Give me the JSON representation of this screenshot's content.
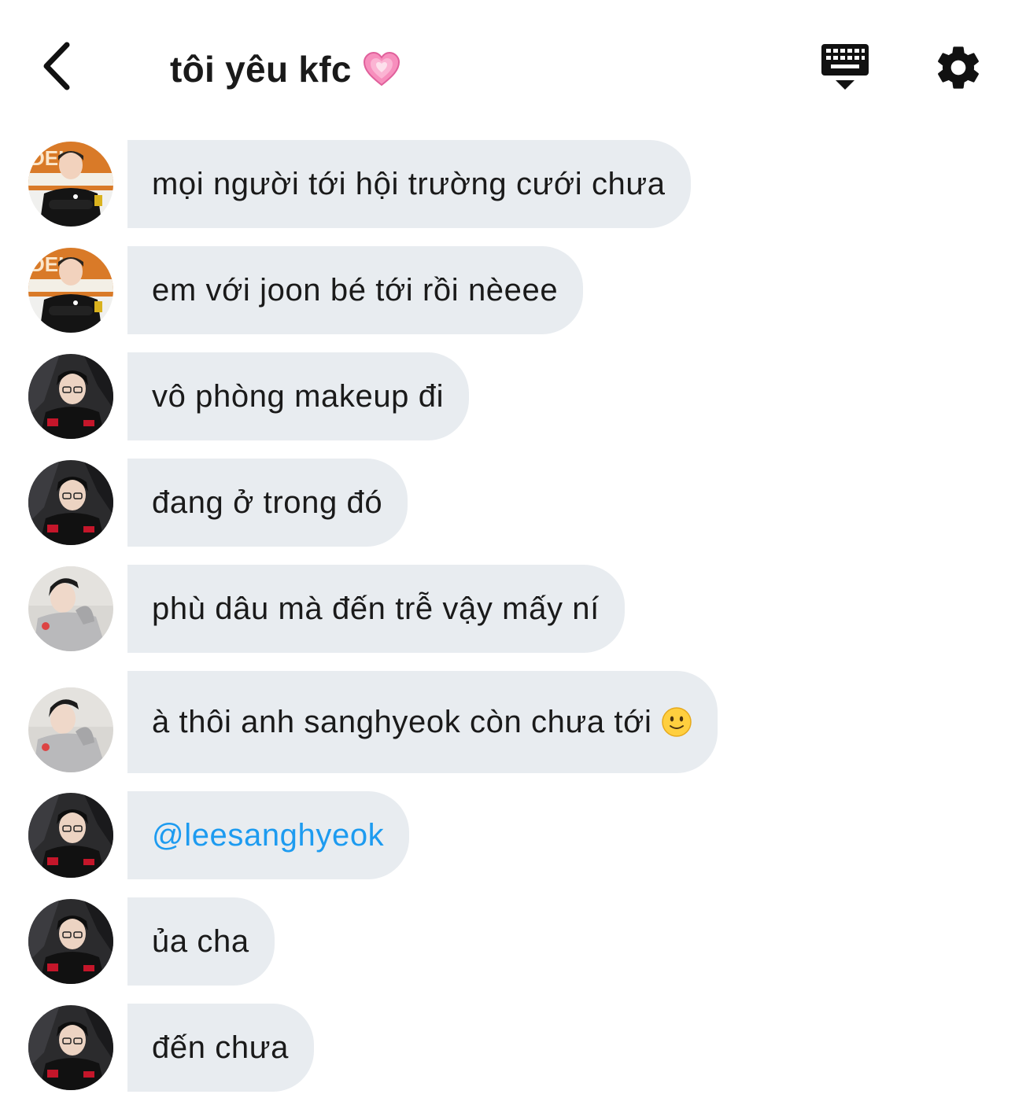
{
  "header": {
    "back_icon": "chevron-left-icon",
    "title": "tôi yêu kfc",
    "title_emoji": "growing-heart-emoji",
    "keyboard_icon": "keyboard-icon",
    "settings_icon": "gear-icon"
  },
  "colors": {
    "bubble_bg": "#e8ecf0",
    "mention": "#1d9bf0",
    "text": "#1a1a1a"
  },
  "messages": [
    {
      "avatar": "avatar-orange-bg",
      "text": "mọi người tới hội trường cưới chưa"
    },
    {
      "avatar": "avatar-orange-bg",
      "text": "em với joon bé tới rồi nèeee"
    },
    {
      "avatar": "avatar-dark-bg",
      "text": "vô phòng makeup đi"
    },
    {
      "avatar": "avatar-dark-bg",
      "text": "đang ở trong đó"
    },
    {
      "avatar": "avatar-light-bg",
      "text": "phù dâu mà đến trễ vậy mấy ní"
    },
    {
      "avatar": "avatar-light-bg",
      "text": "à thôi anh sanghyeok còn chưa tới",
      "emoji": "slightly-smiling-face-emoji"
    },
    {
      "avatar": "avatar-dark-bg",
      "text": "@leesanghyeok",
      "is_mention": true
    },
    {
      "avatar": "avatar-dark-bg",
      "text": "ủa cha"
    },
    {
      "avatar": "avatar-dark-bg",
      "text": "đến chưa"
    }
  ]
}
